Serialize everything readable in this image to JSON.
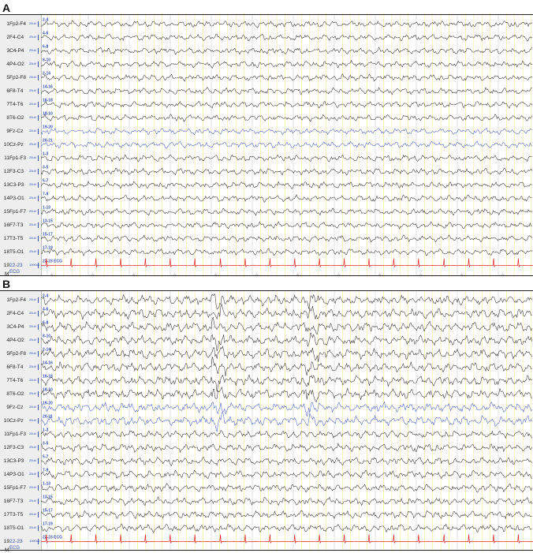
{
  "panels": [
    {
      "letter": "A"
    },
    {
      "letter": "B"
    }
  ],
  "channels": [
    {
      "num": "1",
      "name": "Fp2-F4",
      "gain": "25uV",
      "tag": "2-4",
      "color": "black"
    },
    {
      "num": "2",
      "name": "F4-C4",
      "gain": "25uV",
      "tag": "4-6",
      "color": "black"
    },
    {
      "num": "3",
      "name": "C4-P4",
      "gain": "25uV",
      "tag": "6-8",
      "color": "black"
    },
    {
      "num": "4",
      "name": "P4-O2",
      "gain": "25uV",
      "tag": "8-10",
      "color": "black"
    },
    {
      "num": "5",
      "name": "Fp2-F8",
      "gain": "25uV",
      "tag": "2-14",
      "color": "black"
    },
    {
      "num": "6",
      "name": "F8-T4",
      "gain": "25uV",
      "tag": "14-16",
      "color": "black"
    },
    {
      "num": "7",
      "name": "T4-T6",
      "gain": "25uV",
      "tag": "16-18",
      "color": "black"
    },
    {
      "num": "8",
      "name": "T6-O2",
      "gain": "25uV",
      "tag": "18-10",
      "color": "black"
    },
    {
      "num": "9",
      "name": "Fz-Cz",
      "gain": "25uV",
      "tag": "19-20",
      "color": "blue"
    },
    {
      "num": "10",
      "name": "Cz-Pz",
      "gain": "25uV",
      "tag": "20-21",
      "color": "blue"
    },
    {
      "num": "11",
      "name": "Fp1-F3",
      "gain": "25uV",
      "tag": "1-3",
      "color": "black"
    },
    {
      "num": "12",
      "name": "F3-C3",
      "gain": "25uV",
      "tag": "3-5",
      "color": "black"
    },
    {
      "num": "13",
      "name": "C3-P3",
      "gain": "25uV",
      "tag": "5-7",
      "color": "black"
    },
    {
      "num": "14",
      "name": "P3-O1",
      "gain": "25uV",
      "tag": "7-9",
      "color": "black"
    },
    {
      "num": "15",
      "name": "Fp1-F7",
      "gain": "25uV",
      "tag": "1-13",
      "color": "black"
    },
    {
      "num": "16",
      "name": "F7-T3",
      "gain": "25uV",
      "tag": "13-15",
      "color": "black"
    },
    {
      "num": "17",
      "name": "T3-T5",
      "gain": "25uV",
      "tag": "15-17",
      "color": "black"
    },
    {
      "num": "18",
      "name": "T5-O1",
      "gain": "25uV",
      "tag": "17-19",
      "color": "black"
    },
    {
      "num": "19",
      "name": "22-23",
      "gain": "1000uV",
      "tag": "22-23 ECG",
      "color": "red",
      "sublabel": "ECG"
    }
  ],
  "marker_label": "M",
  "colors": {
    "trace_black": "#333333",
    "trace_blue": "#4a5fc0",
    "trace_red": "#e02020",
    "grid_yellow": "#eeee88",
    "grid_grey": "#cccccc",
    "tag_blue": "#3a52b5"
  }
}
